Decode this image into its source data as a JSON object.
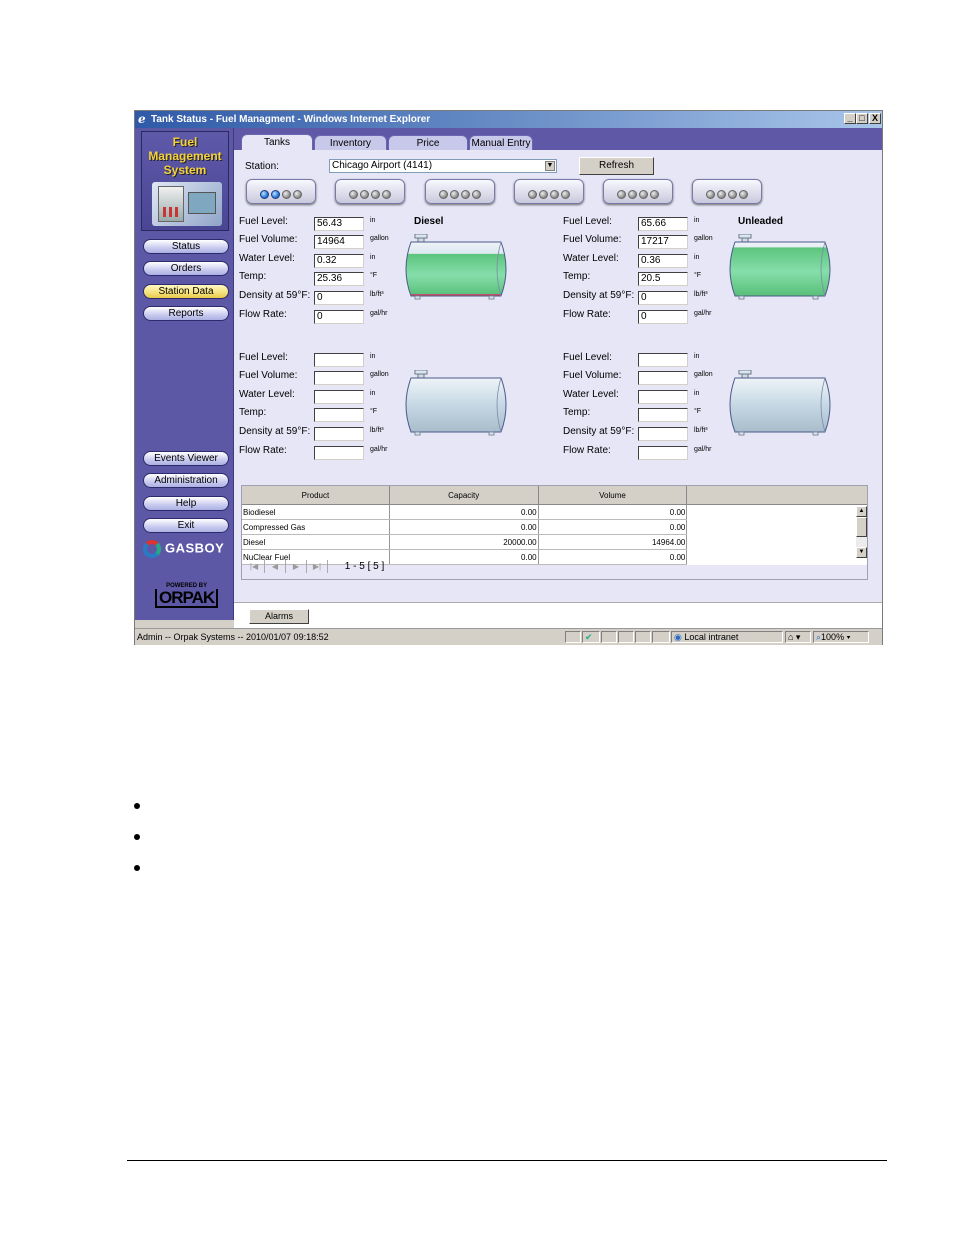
{
  "window": {
    "title": "Tank Status - Fuel Managment - Windows Internet Explorer",
    "controls": [
      "_",
      "□",
      "X"
    ]
  },
  "sidebar": {
    "logo_lines": [
      "Fuel",
      "Management",
      "System"
    ],
    "nav_top": [
      {
        "label": "Status",
        "active": false
      },
      {
        "label": "Orders",
        "active": false
      },
      {
        "label": "Station Data",
        "active": true
      },
      {
        "label": "Reports",
        "active": false
      }
    ],
    "nav_bottom": [
      {
        "label": "Events Viewer"
      },
      {
        "label": "Administration"
      },
      {
        "label": "Help"
      },
      {
        "label": "Exit"
      }
    ],
    "brand": "GASBOY",
    "powered_by": "POWERED BY",
    "powered_brand": "ORPAK"
  },
  "tabs": [
    {
      "label": "Tanks",
      "active": true
    },
    {
      "label": "Inventory",
      "active": false
    },
    {
      "label": "Price",
      "active": false
    },
    {
      "label": "Manual Entry",
      "active": false
    }
  ],
  "station": {
    "label": "Station:",
    "value": "Chicago Airport (4141)",
    "refresh_label": "Refresh"
  },
  "tank_selectors": [
    {
      "lit": 2
    },
    {
      "lit": 0
    },
    {
      "lit": 0
    },
    {
      "lit": 0
    },
    {
      "lit": 0
    },
    {
      "lit": 0
    }
  ],
  "field_labels": {
    "fuel_level": "Fuel Level:",
    "fuel_volume": "Fuel Volume:",
    "water_level": "Water Level:",
    "temp": "Temp:",
    "density": "Density at 59°F:",
    "flow_rate": "Flow Rate:"
  },
  "units": {
    "fuel_level": "in",
    "fuel_volume": "gallon",
    "water_level": "in",
    "temp": "°F",
    "density": "lb/ft³",
    "flow_rate": "gal/hr"
  },
  "tanks": [
    {
      "name": "Diesel",
      "fuel_level": "56.43",
      "fuel_volume": "14964",
      "water_level": "0.32",
      "temp": "25.36",
      "density": "0",
      "flow_rate": "0",
      "fill_fraction": 0.78,
      "water_fraction": 0.02
    },
    {
      "name": "Unleaded",
      "fuel_level": "65.66",
      "fuel_volume": "17217",
      "water_level": "0.36",
      "temp": "20.5",
      "density": "0",
      "flow_rate": "0",
      "fill_fraction": 0.9,
      "water_fraction": 0.0
    },
    {
      "name": "",
      "fuel_level": "",
      "fuel_volume": "",
      "water_level": "",
      "temp": "",
      "density": "",
      "flow_rate": "",
      "fill_fraction": 0,
      "water_fraction": 0
    },
    {
      "name": "",
      "fuel_level": "",
      "fuel_volume": "",
      "water_level": "",
      "temp": "",
      "density": "",
      "flow_rate": "",
      "fill_fraction": 0,
      "water_fraction": 0
    }
  ],
  "inventory_table": {
    "columns": [
      "Product",
      "Capacity",
      "Volume",
      ""
    ],
    "rows": [
      [
        "Biodiesel",
        "0.00",
        "0.00"
      ],
      [
        "Compressed Gas",
        "0.00",
        "0.00"
      ],
      [
        "Diesel",
        "20000.00",
        "14964.00"
      ],
      [
        "NuClear Fuel",
        "0.00",
        "0.00"
      ]
    ],
    "pager_text": "1 - 5  [ 5 ]"
  },
  "bottom": {
    "alarms_label": "Alarms"
  },
  "statusbar": {
    "text": "Admin -- Orpak Systems -- 2010/01/07  09:18:52",
    "zone": "Local intranet",
    "zoom": "100%"
  },
  "colors": {
    "sidebar": "#5d58a5",
    "content": "#e6e6f6",
    "fuel_green": "#6fd08f",
    "active_nav": "#f5e17a",
    "selector_lit": "#2a7bd8"
  }
}
